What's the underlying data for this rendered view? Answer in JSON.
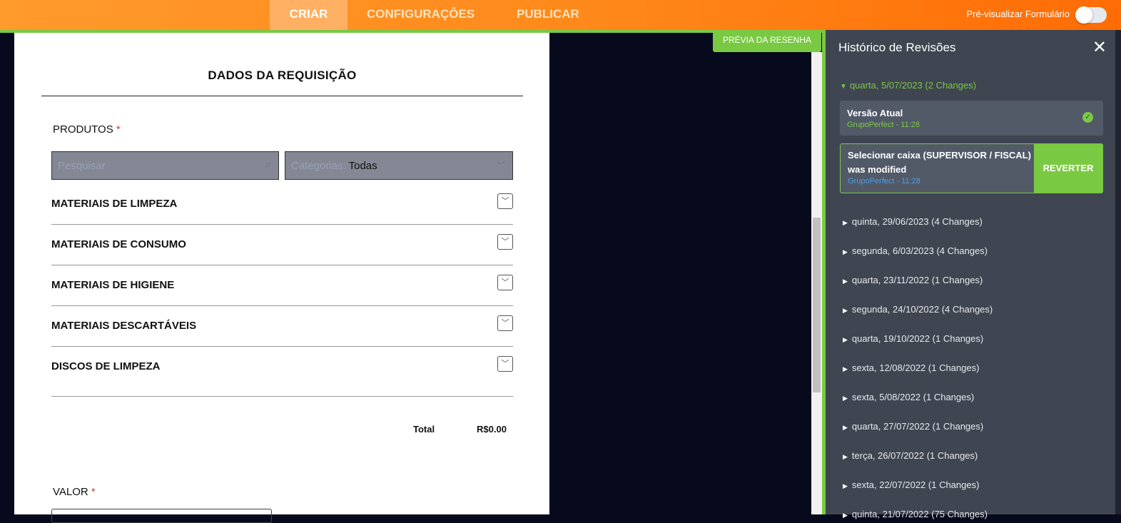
{
  "topbar": {
    "tabs": [
      "CRIAR",
      "CONFIGURAÇÕES",
      "PUBLICAR"
    ],
    "active": "CRIAR",
    "preview_label": "Pré-visualizar Formulário",
    "preview_on": false
  },
  "form": {
    "title": "DADOS DA REQUISIÇÃO",
    "produtos_label": "PRODUTOS",
    "required_mark": "*",
    "search_placeholder": "Pesquisar",
    "categories_label": "Categorias:",
    "categories_value": "Todas",
    "categories": [
      "MATERIAIS DE LIMPEZA",
      "MATERIAIS DE CONSUMO",
      "MATERIAIS DE HIGIENE",
      "MATERIAIS DESCARTÁVEIS",
      "DISCOS DE LIMPEZA"
    ],
    "total_label": "Total",
    "total_value": "R$0.00",
    "valor_label": "VALOR"
  },
  "resenha_button": "PRÉVIA DA RESENHA",
  "history": {
    "title": "Histórico de Revisões",
    "open_day": "quarta, 5/07/2023 (2 Changes)",
    "current": {
      "title": "Versão Atual",
      "meta": "GrupoPerfect - 11:28"
    },
    "change": {
      "title": "Selecionar caixa (SUPERVISOR / FISCAL) was modified",
      "meta": "GrupoPerfect - 11:28",
      "revert_label": "REVERTER"
    },
    "days": [
      "quinta, 29/06/2023 (4 Changes)",
      "segunda, 6/03/2023 (4 Changes)",
      "quarta, 23/11/2022 (1 Changes)",
      "segunda, 24/10/2022 (4 Changes)",
      "quarta, 19/10/2022 (1 Changes)",
      "sexta, 12/08/2022 (1 Changes)",
      "sexta, 5/08/2022 (1 Changes)",
      "quarta, 27/07/2022 (1 Changes)",
      "terça, 26/07/2022 (1 Changes)",
      "sexta, 22/07/2022 (1 Changes)",
      "quinta, 21/07/2022 (75 Changes)"
    ]
  },
  "colors": {
    "accent": "#7ac943",
    "orange": "#ff8a1c",
    "panel": "#3f4551"
  }
}
